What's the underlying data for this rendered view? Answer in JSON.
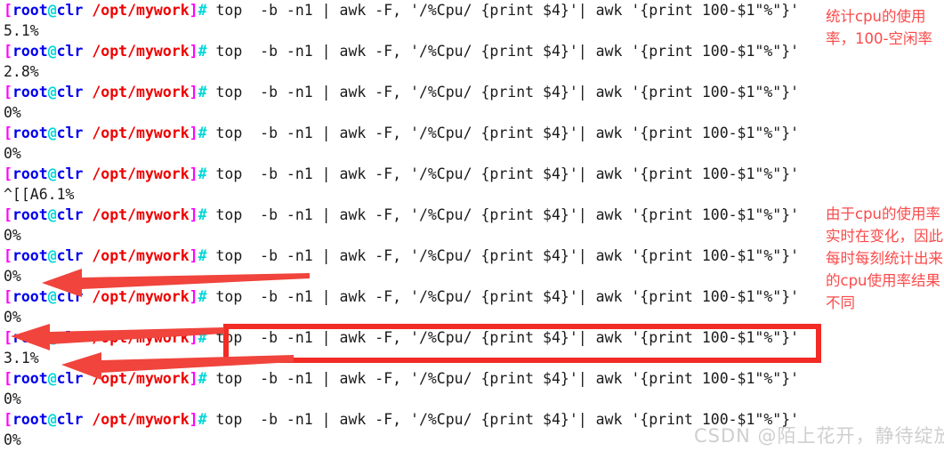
{
  "terminal": {
    "prompt": {
      "open_bracket": "[",
      "user": "root",
      "at": "@",
      "host": "clr",
      "space": " ",
      "path": "/opt/mywork",
      "close_bracket": "]",
      "hash": "#"
    },
    "command": " top  -b -n1 | awk -F, '/%Cpu/ {print $4}'| awk '{print 100-$1\"%\"}'",
    "entries": [
      {
        "command": " top  -b -n1 | awk -F, '/%Cpu/ {print $4}'| awk '{print 100-$1\"%\"}'",
        "output": "5.1%"
      },
      {
        "command": " top  -b -n1 | awk -F, '/%Cpu/ {print $4}'| awk '{print 100-$1\"%\"}'",
        "output": "2.8%"
      },
      {
        "command": " top  -b -n1 | awk -F, '/%Cpu/ {print $4}'| awk '{print 100-$1\"%\"}'",
        "output": "0%"
      },
      {
        "command": " top  -b -n1 | awk -F, '/%Cpu/ {print $4}'| awk '{print 100-$1\"%\"}'",
        "output": "0%"
      },
      {
        "command": " top  -b -n1 | awk -F, '/%Cpu/ {print $4}'| awk '{print 100-$1\"%\"}'",
        "output": "^[[A6.1%"
      },
      {
        "command": " top  -b -n1 | awk -F, '/%Cpu/ {print $4}'| awk '{print 100-$1\"%\"}'",
        "output": "0%"
      },
      {
        "command": " top  -b -n1 | awk -F, '/%Cpu/ {print $4}'| awk '{print 100-$1\"%\"}'",
        "output": "0%"
      },
      {
        "command": " top  -b -n1 | awk -F, '/%Cpu/ {print $4}'| awk '{print 100-$1\"%\"}'",
        "output": "0%"
      },
      {
        "command": " top  -b -n1 | awk -F, '/%Cpu/ {print $4}'| awk '{print 100-$1\"%\"}'",
        "output": "3.1%"
      },
      {
        "command": " top  -b -n1 | awk -F, '/%Cpu/ {print $4}'| awk '{print 100-$1\"%\"}'",
        "output": "0%"
      },
      {
        "command": " top  -b -n1 | awk -F, '/%Cpu/ {print $4}'| awk '{print 100-$1\"%\"}'",
        "output": "0%"
      }
    ]
  },
  "annotations": {
    "cpu_usage": "统计cpu的使用率，100-空闲率",
    "realtime": "由于cpu的使用率实时在变化，因此每时每刻统计出来的cpu使用率结果不同"
  },
  "colors": {
    "prompt_bracket": "#ff00ff",
    "prompt_user": "#0000ee",
    "prompt_at": "#00d7d7",
    "prompt_path": "#ee0000",
    "annotation": "#fb4a4a",
    "highlight_box": "#f22b25",
    "arrow": "#f0443c",
    "text": "#1a1a1a",
    "background": "#ffffff"
  },
  "watermark": "CSDN @陌上花开，静待绽放！"
}
